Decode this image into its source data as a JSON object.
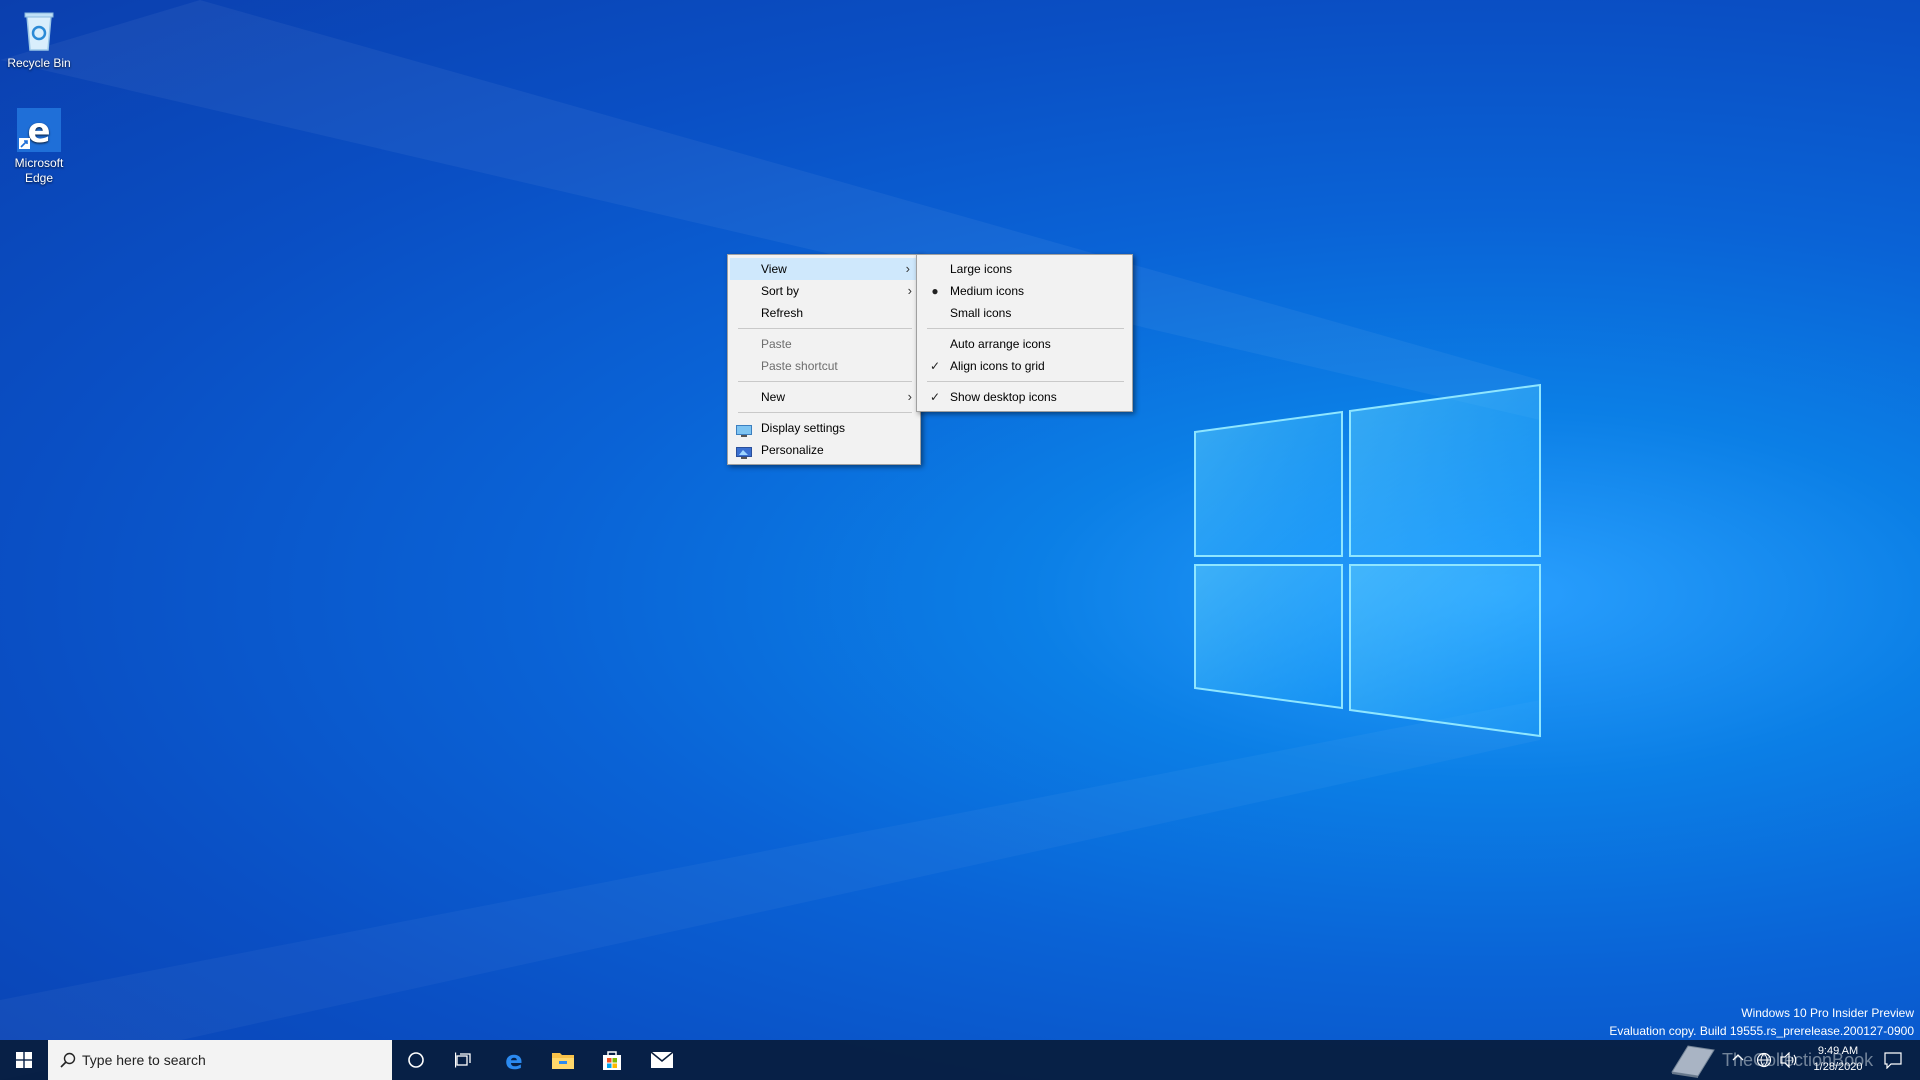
{
  "desktop": {
    "icons": [
      {
        "label": "Recycle Bin"
      },
      {
        "label": "Microsoft Edge"
      }
    ]
  },
  "context_menu": {
    "items": [
      {
        "label": "View"
      },
      {
        "label": "Sort by"
      },
      {
        "label": "Refresh"
      },
      {
        "label": "Paste"
      },
      {
        "label": "Paste shortcut"
      },
      {
        "label": "New"
      },
      {
        "label": "Display settings"
      },
      {
        "label": "Personalize"
      }
    ]
  },
  "view_submenu": {
    "items": [
      {
        "label": "Large icons"
      },
      {
        "label": "Medium icons"
      },
      {
        "label": "Small icons"
      },
      {
        "label": "Auto arrange icons"
      },
      {
        "label": "Align icons to grid"
      },
      {
        "label": "Show desktop icons"
      }
    ]
  },
  "taskbar": {
    "search_placeholder": "Type here to search",
    "pinned": [
      "cortana-icon",
      "task-view-icon",
      "edge-icon",
      "file-explorer-icon",
      "store-icon",
      "mail-icon"
    ],
    "clock_time": "9:49 AM",
    "clock_date": "1/28/2020"
  },
  "watermark": {
    "line1": "Windows 10 Pro Insider Preview",
    "line2": "Evaluation copy. Build 19555.rs_prerelease.200127-0900"
  },
  "overlay_logo_text": "TheCollectionBook",
  "colors": {
    "menu_bg": "#f2f2f2",
    "menu_hover": "#cfe8fc",
    "taskbar_bg": "#0a1d3d",
    "desktop_blue": "#0a63d6"
  }
}
